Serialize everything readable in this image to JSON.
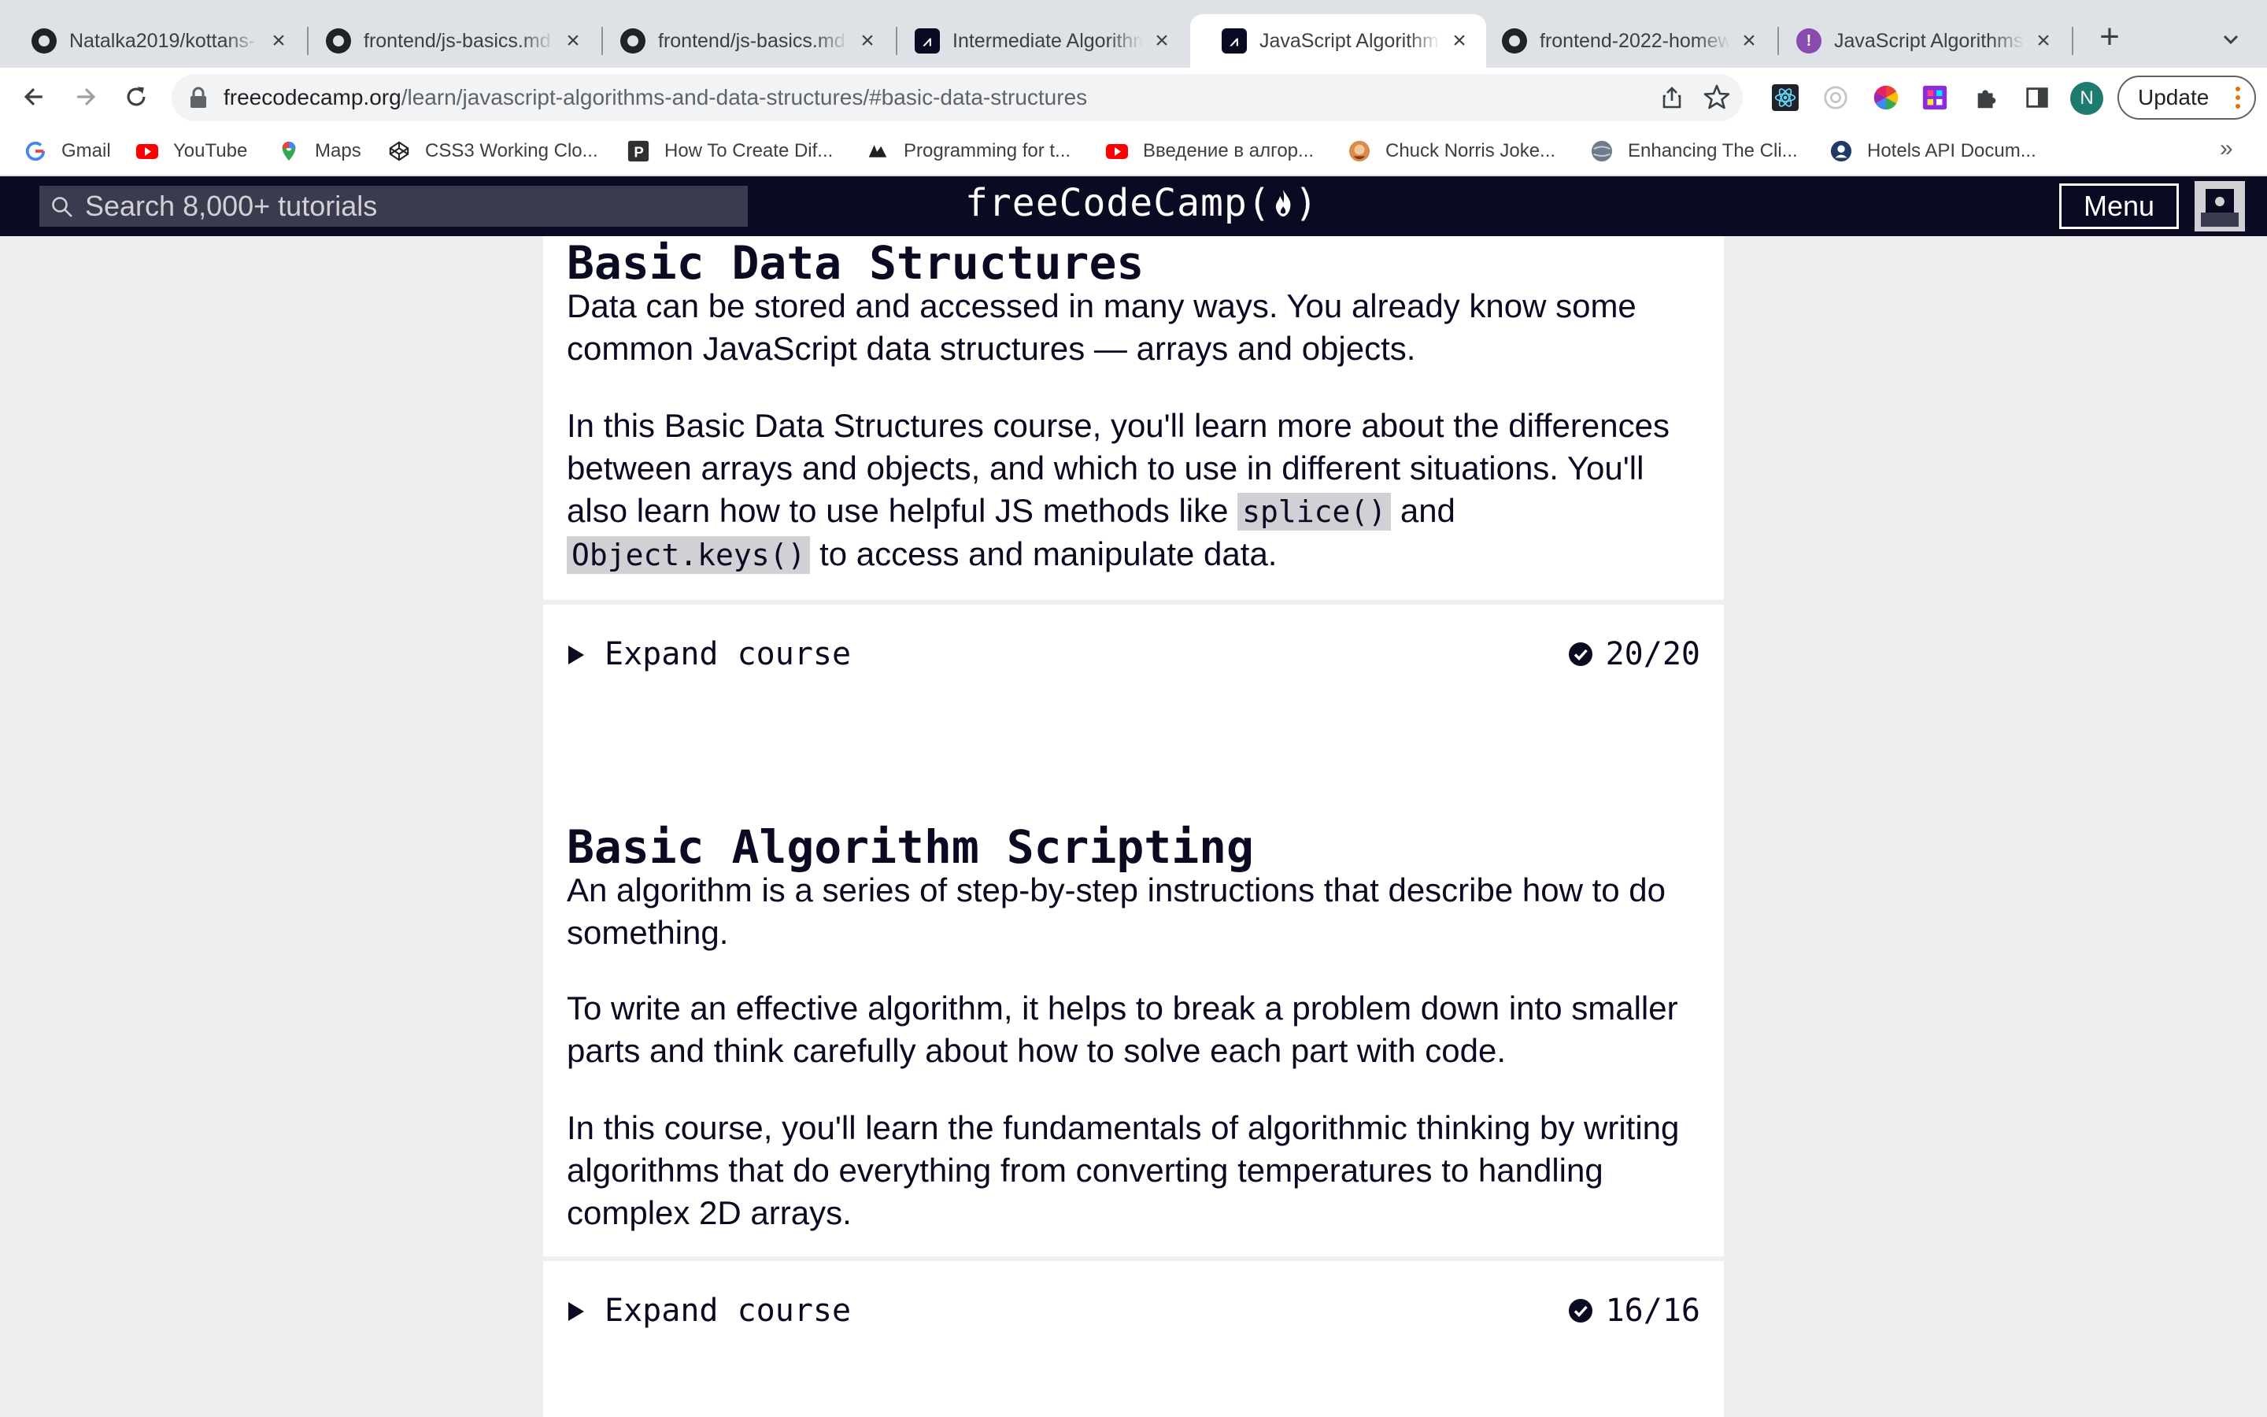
{
  "browser": {
    "tabs": [
      {
        "title": "Natalka2019/kottans-",
        "favicon": "github-icon",
        "active": false
      },
      {
        "title": "frontend/js-basics.md",
        "favicon": "github-icon",
        "active": false
      },
      {
        "title": "frontend/js-basics.md",
        "favicon": "github-icon",
        "active": false
      },
      {
        "title": "Intermediate Algorithm",
        "favicon": "freecodecamp-icon",
        "active": false
      },
      {
        "title": "JavaScript Algorithms",
        "favicon": "freecodecamp-icon",
        "active": true
      },
      {
        "title": "frontend-2022-homew",
        "favicon": "github-icon",
        "active": false
      },
      {
        "title": "JavaScript Algorithms",
        "favicon": "hotels-icon",
        "active": false
      }
    ],
    "address": {
      "host": "freecodecamp.org",
      "path": "/learn/javascript-algorithms-and-data-structures/#basic-data-structures"
    },
    "profile_initial": "N",
    "update_label": "Update",
    "bookmarks": [
      {
        "label": "Gmail",
        "icon": "gmail-icon"
      },
      {
        "label": "YouTube",
        "icon": "youtube-icon"
      },
      {
        "label": "Maps",
        "icon": "maps-icon"
      },
      {
        "label": "CSS3 Working Clo...",
        "icon": "codepen-icon"
      },
      {
        "label": "How To Create Dif...",
        "icon": "p-logo-icon"
      },
      {
        "label": "Programming for t...",
        "icon": "site-icon"
      },
      {
        "label": "Введение в алгор...",
        "icon": "youtube-icon"
      },
      {
        "label": "Chuck Norris Joke...",
        "icon": "chuck-norris-icon"
      },
      {
        "label": "Enhancing The Cli...",
        "icon": "globe-icon"
      },
      {
        "label": "Hotels API Docum...",
        "icon": "hotels-api-icon"
      }
    ],
    "bookmarks_overflow": "»"
  },
  "fcc_header": {
    "search_placeholder": "Search 8,000+ tutorials",
    "logo_text": "freeCodeCamp(",
    "logo_close": ")",
    "menu_label": "Menu"
  },
  "courses": [
    {
      "title": "Basic Data Structures",
      "paragraphs": [
        "Data can be stored and accessed in many ways. You already know some common JavaScript data structures — arrays and objects."
      ],
      "methods_paragraph": {
        "before": "In this Basic Data Structures course, you'll learn more about the differences between arrays and objects, and which to use in different situations. You'll also learn how to use helpful JS methods like ",
        "code1": "splice()",
        "middle": " and ",
        "code2": "Object.keys()",
        "after": " to access and manipulate data."
      },
      "expand_label": "Expand course",
      "progress": "20/20",
      "completed": 20,
      "total": 20
    },
    {
      "title": "Basic Algorithm Scripting",
      "paragraphs": [
        "An algorithm is a series of step-by-step instructions that describe how to do something.",
        "To write an effective algorithm, it helps to break a problem down into smaller parts and think carefully about how to solve each part with code.",
        "In this course, you'll learn the fundamentals of algorithmic thinking by writing algorithms that do everything from converting temperatures to handling complex 2D arrays."
      ],
      "expand_label": "Expand course",
      "progress": "16/16",
      "completed": 16,
      "total": 16
    }
  ]
}
